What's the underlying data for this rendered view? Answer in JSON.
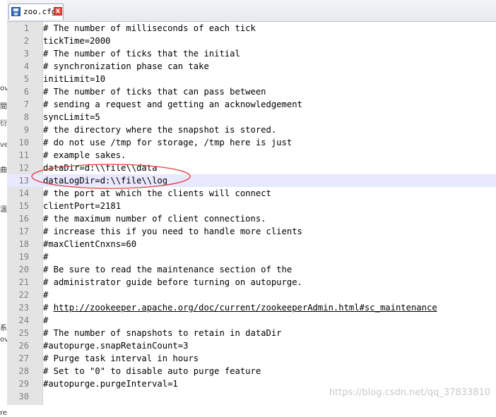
{
  "tab": {
    "label": "zoo.cfg",
    "close_glyph": "x",
    "icon": "save-disk-icon"
  },
  "left_strip": [
    "ov",
    "間",
    "衍",
    "ve",
    "曲",
    "溫",
    "系",
    "ov",
    "re"
  ],
  "editor": {
    "current_line": 13,
    "lines": [
      {
        "num": "1",
        "text": "# The number of milliseconds of each tick"
      },
      {
        "num": "2",
        "text": "tickTime=2000"
      },
      {
        "num": "3",
        "text": "# The number of ticks that the initial"
      },
      {
        "num": "4",
        "text": "# synchronization phase can take"
      },
      {
        "num": "5",
        "text": "initLimit=10"
      },
      {
        "num": "6",
        "text": "# The number of ticks that can pass between"
      },
      {
        "num": "7",
        "text": "# sending a request and getting an acknowledgement"
      },
      {
        "num": "8",
        "text": "syncLimit=5"
      },
      {
        "num": "9",
        "text": "# the directory where the snapshot is stored."
      },
      {
        "num": "10",
        "text": "# do not use /tmp for storage, /tmp here is just"
      },
      {
        "num": "11",
        "text": "# example sakes."
      },
      {
        "num": "12",
        "text": "dataDir=d:\\\\file\\\\data"
      },
      {
        "num": "13",
        "text": "dataLogDir=d:\\\\file\\\\log"
      },
      {
        "num": "14",
        "text": "# the port at which the clients will connect"
      },
      {
        "num": "15",
        "text": "clientPort=2181"
      },
      {
        "num": "16",
        "text": "# the maximum number of client connections."
      },
      {
        "num": "17",
        "text": "# increase this if you need to handle more clients"
      },
      {
        "num": "18",
        "text": "#maxClientCnxns=60"
      },
      {
        "num": "19",
        "text": "#"
      },
      {
        "num": "20",
        "text": "# Be sure to read the maintenance section of the"
      },
      {
        "num": "21",
        "text": "# administrator guide before turning on autopurge."
      },
      {
        "num": "22",
        "text": "#"
      },
      {
        "num": "23",
        "text": "# ",
        "link": "http://zookeeper.apache.org/doc/current/zookeeperAdmin.html#sc_maintenance"
      },
      {
        "num": "24",
        "text": "#"
      },
      {
        "num": "25",
        "text": "# The number of snapshots to retain in dataDir"
      },
      {
        "num": "26",
        "text": "#autopurge.snapRetainCount=3"
      },
      {
        "num": "27",
        "text": "# Purge task interval in hours"
      },
      {
        "num": "28",
        "text": "# Set to \"0\" to disable auto purge feature"
      },
      {
        "num": "29",
        "text": "#autopurge.purgeInterval=1"
      },
      {
        "num": "30",
        "text": ""
      }
    ]
  },
  "annotation": {
    "color": "#e0403a"
  },
  "watermark": "https://blog.csdn.net/qq_37833810"
}
